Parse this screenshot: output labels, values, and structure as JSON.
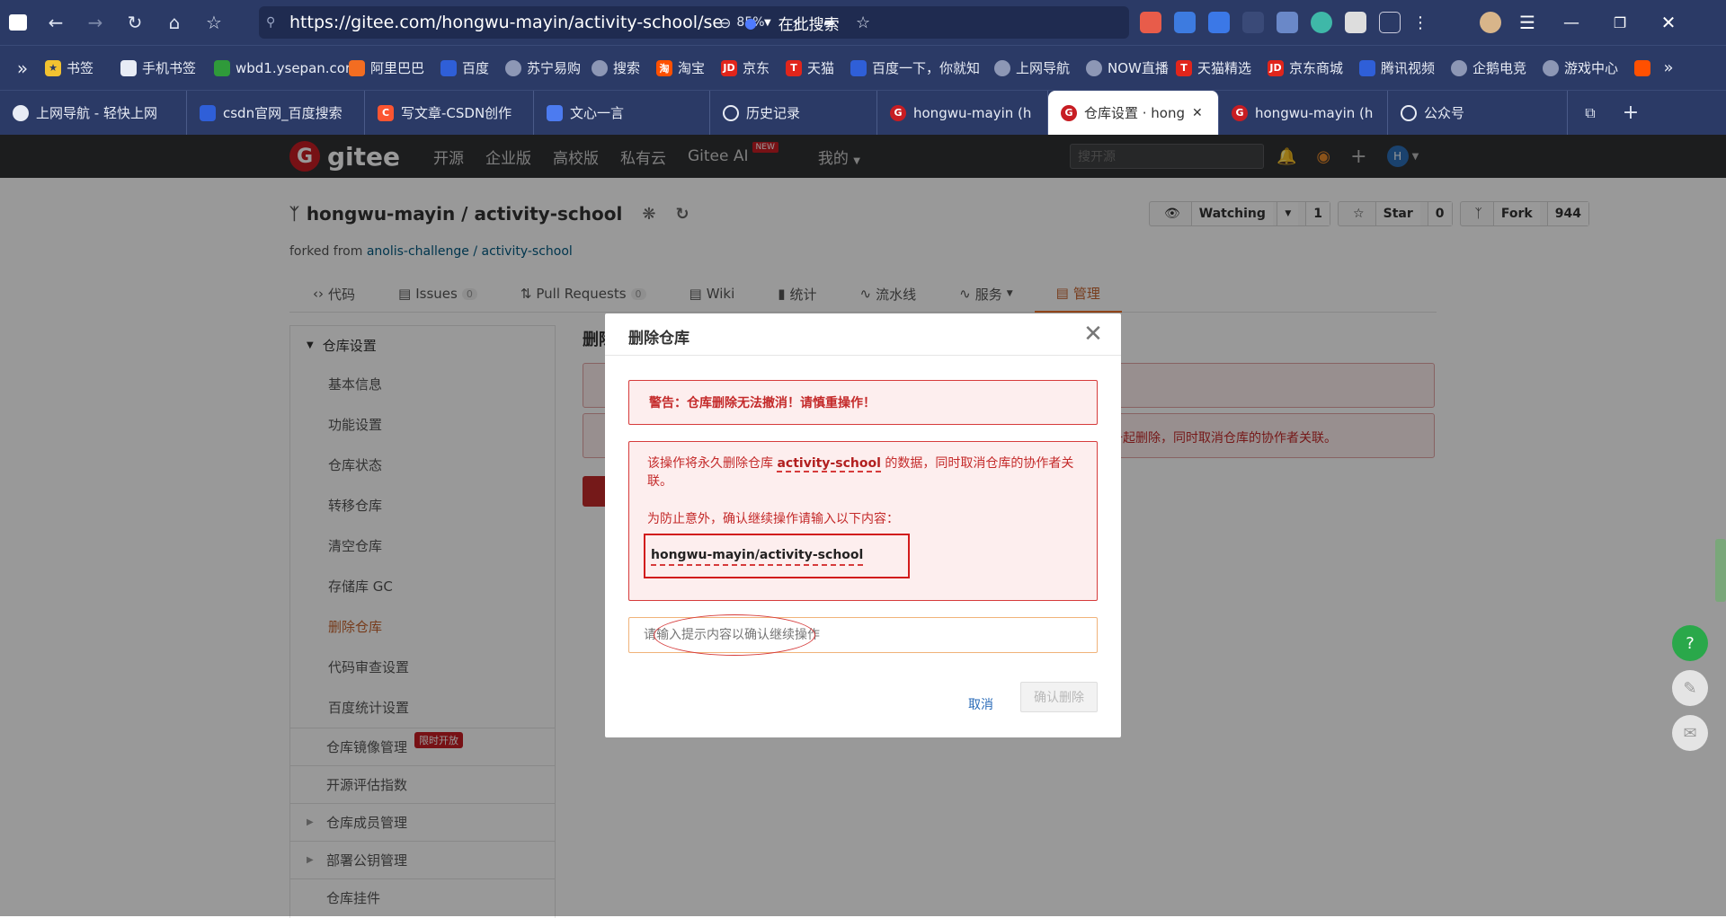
{
  "browser": {
    "url": "https://gitee.com/hongwu-mayin/activity-school/se",
    "zoom": "85%",
    "search_placeholder": "在此搜索",
    "bookmarks": [
      "书签",
      "手机书签",
      "wbd1.ysepan.cor",
      "阿里巴巴",
      "百度",
      "苏宁易购",
      "搜索",
      "淘宝",
      "京东",
      "天猫",
      "百度一下，你就知",
      "上网导航",
      "NOW直播",
      "天猫精选",
      "京东商城",
      "腾讯视频",
      "企鹅电竞",
      "游戏中心"
    ],
    "tabs": [
      "上网导航 - 轻快上网",
      "csdn官网_百度搜索",
      "写文章-CSDN创作",
      "文心一言",
      "历史记录",
      "hongwu-mayin (h",
      "仓库设置 · hong",
      "hongwu-mayin (h",
      "公众号"
    ],
    "colors": {
      "chrome": "#2b3a66"
    }
  },
  "gitee": {
    "logo_text": "gitee",
    "nav": [
      "开源",
      "企业版",
      "高校版",
      "私有云",
      "Gitee AI",
      "我的"
    ],
    "new_badge": "NEW",
    "search_placeholder": "搜开源",
    "avatar_letter": "H",
    "brand_color": "#c71d23"
  },
  "repo": {
    "title": "hongwu-mayin / activity-school",
    "forked_prefix": "forked from",
    "forked_link": "anolis-challenge / activity-school",
    "watching_label": "Watching",
    "watching_count": "1",
    "star_label": "Star",
    "star_count": "0",
    "fork_label": "Fork",
    "fork_count": "944",
    "tabs": [
      {
        "label": "代码"
      },
      {
        "label": "Issues",
        "count": "0"
      },
      {
        "label": "Pull Requests",
        "count": "0"
      },
      {
        "label": "Wiki"
      },
      {
        "label": "统计"
      },
      {
        "label": "流水线"
      },
      {
        "label": "服务"
      },
      {
        "label": "管理"
      }
    ]
  },
  "sidebar": {
    "header": "仓库设置",
    "items": [
      "基本信息",
      "功能设置",
      "仓库状态",
      "转移仓库",
      "清空仓库",
      "存储库 GC",
      "删除仓库",
      "代码审查设置",
      "百度统计设置"
    ],
    "sections": [
      "仓库镜像管理",
      "开源评估指数",
      "仓库成员管理",
      "部署公钥管理",
      "仓库挂件"
    ],
    "mirror_badge": "限时开放"
  },
  "main_bg": {
    "title_partial": "删除",
    "alert2_tail": "一起删除，同时取消仓库的协作者关联。"
  },
  "modal": {
    "title": "删除仓库",
    "warning": "警告：仓库删除无法撤消！请慎重操作！",
    "desc_prefix": "该操作将永久删除仓库",
    "desc_repo": "activity-school",
    "desc_suffix": "的数据，同时取消仓库的协作者关联。",
    "prompt": "为防止意外，确认继续操作请输入以下内容：",
    "confirm_text": "hongwu-mayin/activity-school",
    "input_placeholder": "请输入提示内容以确认继续操作",
    "cancel_label": "取消",
    "confirm_label": "确认删除"
  }
}
